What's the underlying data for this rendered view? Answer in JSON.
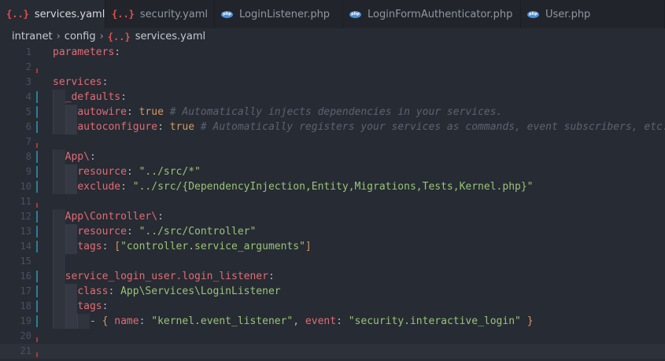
{
  "tabs": [
    {
      "label": "services.yaml",
      "icon": "yaml-icon",
      "active": true,
      "modified": true
    },
    {
      "label": "security.yaml",
      "icon": "yaml-icon",
      "active": false
    },
    {
      "label": "LoginListener.php",
      "icon": "php-icon",
      "active": false
    },
    {
      "label": "LoginFormAuthenticator.php",
      "icon": "php-icon",
      "active": false
    },
    {
      "label": "User.php",
      "icon": "php-icon",
      "active": false
    }
  ],
  "icons": {
    "yaml": "{..}",
    "php": "php"
  },
  "breadcrumb": [
    "intranet",
    "config",
    "services.yaml"
  ],
  "editor": {
    "language": "yaml",
    "current_line": 21,
    "lines": [
      {
        "n": 1,
        "indent": 0,
        "mark": "",
        "tokens": [
          [
            "k",
            "parameters"
          ],
          [
            "p",
            ":"
          ]
        ]
      },
      {
        "n": 2,
        "indent": 0,
        "mark": "red",
        "tokens": []
      },
      {
        "n": 3,
        "indent": 0,
        "mark": "",
        "tokens": [
          [
            "k",
            "services"
          ],
          [
            "p",
            ":"
          ]
        ]
      },
      {
        "n": 4,
        "indent": 1,
        "mark": "blue",
        "tokens": [
          [
            "k",
            "_defaults"
          ],
          [
            "p",
            ":"
          ]
        ]
      },
      {
        "n": 5,
        "indent": 2,
        "mark": "blue",
        "tokens": [
          [
            "k",
            "autowire"
          ],
          [
            "p",
            ": "
          ],
          [
            "b",
            "true"
          ],
          [
            "c",
            " # Automatically injects dependencies in your services."
          ]
        ]
      },
      {
        "n": 6,
        "indent": 2,
        "mark": "blue",
        "tokens": [
          [
            "k",
            "autoconfigure"
          ],
          [
            "p",
            ": "
          ],
          [
            "b",
            "true"
          ],
          [
            "c",
            " # Automatically registers your services as commands, event subscribers, etc."
          ]
        ]
      },
      {
        "n": 7,
        "indent": 0,
        "mark": "red",
        "tokens": []
      },
      {
        "n": 8,
        "indent": 1,
        "mark": "blue",
        "tokens": [
          [
            "k",
            "App\\"
          ],
          [
            "p",
            ":"
          ]
        ]
      },
      {
        "n": 9,
        "indent": 2,
        "mark": "blue",
        "tokens": [
          [
            "k",
            "resource"
          ],
          [
            "p",
            ": "
          ],
          [
            "s",
            "\"../src/*\""
          ]
        ]
      },
      {
        "n": 10,
        "indent": 2,
        "mark": "blue",
        "tokens": [
          [
            "k",
            "exclude"
          ],
          [
            "p",
            ": "
          ],
          [
            "s",
            "\"../src/{DependencyInjection,Entity,Migrations,Tests,Kernel.php}\""
          ]
        ]
      },
      {
        "n": 11,
        "indent": 0,
        "mark": "red",
        "tokens": []
      },
      {
        "n": 12,
        "indent": 1,
        "mark": "blue",
        "tokens": [
          [
            "k",
            "App\\Controller\\"
          ],
          [
            "p",
            ":"
          ]
        ]
      },
      {
        "n": 13,
        "indent": 2,
        "mark": "blue",
        "tokens": [
          [
            "k",
            "resource"
          ],
          [
            "p",
            ": "
          ],
          [
            "s",
            "\"../src/Controller\""
          ]
        ]
      },
      {
        "n": 14,
        "indent": 2,
        "mark": "blue",
        "tokens": [
          [
            "k",
            "tags"
          ],
          [
            "p",
            ": "
          ],
          [
            "b",
            "["
          ],
          [
            "s",
            "\"controller.service_arguments\""
          ],
          [
            "b",
            "]"
          ]
        ]
      },
      {
        "n": 15,
        "indent": 1,
        "mark": "",
        "tokens": []
      },
      {
        "n": 16,
        "indent": 1,
        "mark": "blue",
        "tokens": [
          [
            "k",
            "service_login_user.login_listener"
          ],
          [
            "p",
            ":"
          ]
        ]
      },
      {
        "n": 17,
        "indent": 2,
        "mark": "blue",
        "tokens": [
          [
            "k",
            "class"
          ],
          [
            "p",
            ": "
          ],
          [
            "s",
            "App\\Services\\LoginListener"
          ]
        ]
      },
      {
        "n": 18,
        "indent": 2,
        "mark": "blue",
        "tokens": [
          [
            "k",
            "tags"
          ],
          [
            "p",
            ":"
          ]
        ]
      },
      {
        "n": 19,
        "indent": 3,
        "mark": "blue",
        "tokens": [
          [
            "p",
            "- "
          ],
          [
            "b",
            "{ "
          ],
          [
            "k",
            "name"
          ],
          [
            "p",
            ": "
          ],
          [
            "s",
            "\"kernel.event_listener\""
          ],
          [
            "p",
            ", "
          ],
          [
            "k",
            "event"
          ],
          [
            "p",
            ": "
          ],
          [
            "s",
            "\"security.interactive_login\""
          ],
          [
            "b",
            " }"
          ]
        ]
      },
      {
        "n": 20,
        "indent": 0,
        "mark": "red",
        "tokens": []
      },
      {
        "n": 21,
        "indent": 0,
        "mark": "red",
        "tokens": []
      }
    ]
  }
}
